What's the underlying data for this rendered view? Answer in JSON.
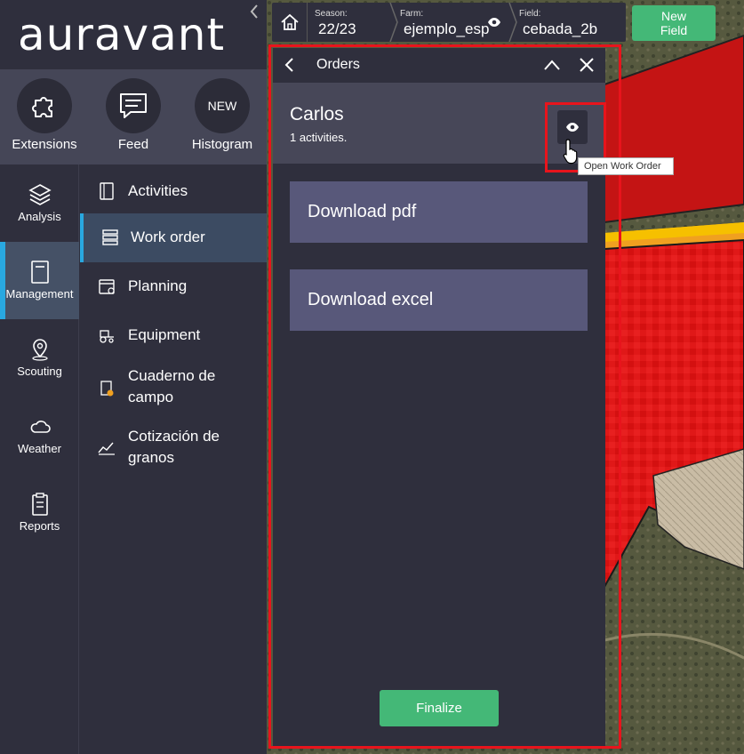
{
  "brand": {
    "logo": "auravant"
  },
  "quick_actions": [
    {
      "label": "Extensions",
      "icon": "puzzle-icon"
    },
    {
      "label": "Feed",
      "icon": "chat-icon"
    },
    {
      "label": "Histogram",
      "badge": "NEW"
    }
  ],
  "nav": [
    {
      "label": "Analysis",
      "icon": "layers-icon"
    },
    {
      "label": "Management",
      "icon": "notebook-icon",
      "active": true
    },
    {
      "label": "Scouting",
      "icon": "map-pin-icon"
    },
    {
      "label": "Weather",
      "icon": "cloud-icon"
    },
    {
      "label": "Reports",
      "icon": "clipboard-icon"
    }
  ],
  "submenu": [
    {
      "label": "Activities",
      "icon": "book-icon"
    },
    {
      "label": "Work order",
      "icon": "stack-icon",
      "active": true
    },
    {
      "label": "Planning",
      "icon": "calendar-icon"
    },
    {
      "label": "Equipment",
      "icon": "tractor-icon"
    },
    {
      "label": "Cuaderno de campo",
      "icon": "field-notebook-icon"
    },
    {
      "label": "Cotización de granos",
      "icon": "chart-icon"
    }
  ],
  "topbar": {
    "season_label": "Season:",
    "season_value": "22/23",
    "farm_label": "Farm:",
    "farm_value": "ejemplo_esp",
    "field_label": "Field:",
    "field_value": "cebada_2b",
    "new_field": "New Field"
  },
  "panel": {
    "title": "Orders",
    "order_name": "Carlos",
    "order_count": "1 activities.",
    "download_pdf": "Download pdf",
    "download_excel": "Download excel",
    "finalize": "Finalize",
    "tooltip": "Open Work Order"
  },
  "colors": {
    "accent_green": "#44b877",
    "accent_blue": "#29a8e0",
    "annotation_red": "#e8141c"
  }
}
